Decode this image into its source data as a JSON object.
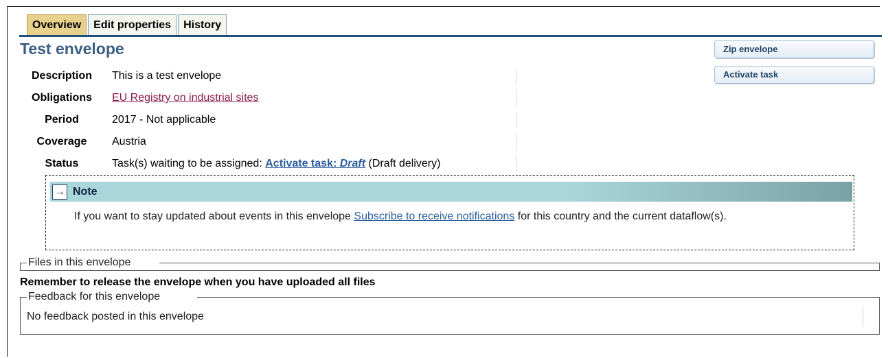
{
  "tabs": [
    {
      "label": "Overview",
      "active": true
    },
    {
      "label": "Edit properties",
      "active": false
    },
    {
      "label": "History",
      "active": false
    }
  ],
  "envelope": {
    "title": "Test envelope"
  },
  "actions": {
    "zip_label": "Zip envelope",
    "activate_label": "Activate task"
  },
  "properties": {
    "description_label": "Description",
    "description_value": "This is a test envelope",
    "obligations_label": "Obligations",
    "obligations_value": "EU Registry on industrial sites",
    "period_label": "Period",
    "period_value": "2017 - Not applicable",
    "coverage_label": "Coverage",
    "coverage_value": "Austria",
    "status_label": "Status",
    "status_prefix": "Task(s) waiting to be assigned:",
    "status_link_prefix": "Activate task:",
    "status_link_emph": "Draft",
    "status_suffix": "(Draft delivery)"
  },
  "note": {
    "title": "Note",
    "text_before": "If you want to stay updated about events in this envelope",
    "link": "Subscribe to receive notifications",
    "text_after": "for this country and the current dataflow(s)."
  },
  "files": {
    "legend": "Files in this envelope",
    "reminder": "Remember to release the envelope when you have uploaded all files"
  },
  "feedback": {
    "legend": "Feedback for this envelope",
    "empty": "No feedback posted in this envelope"
  },
  "colors": {
    "accent": "#1f4f7a",
    "tab_active": "#e8d08d",
    "note_header": "#a9d5db",
    "link": "#2b5e9e",
    "obligation_link": "#8b1a4a"
  }
}
